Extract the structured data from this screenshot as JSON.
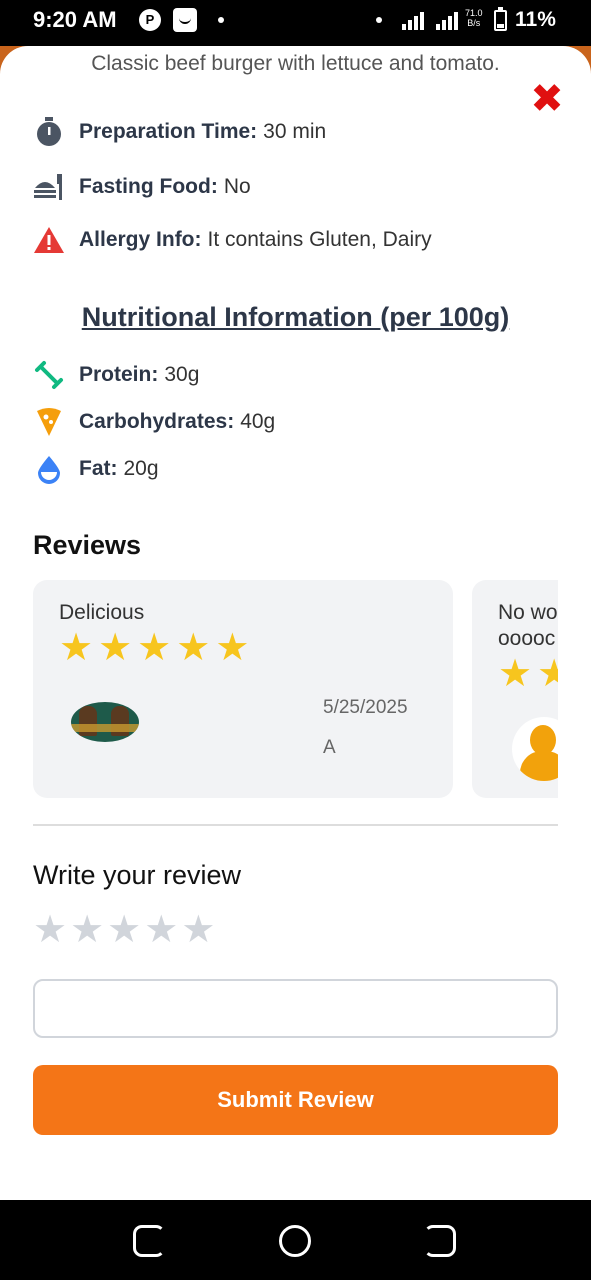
{
  "status_bar": {
    "time": "9:20 AM",
    "app_icon_letter": "P",
    "net_speed_value": "71.0",
    "net_speed_unit": "B/s",
    "battery_percent": "11%"
  },
  "product": {
    "description": "Classic beef burger with lettuce and tomato."
  },
  "details": [
    {
      "icon": "stopwatch-icon",
      "label": "Preparation Time:",
      "value": "30 min",
      "color": "#4b5563"
    },
    {
      "icon": "utensils-icon",
      "label": "Fasting Food:",
      "value": "No",
      "color": "#4b5563"
    },
    {
      "icon": "warning-icon",
      "label": "Allergy Info:",
      "value": "It contains Gluten, Dairy",
      "color": "#e53935"
    }
  ],
  "nutrition": {
    "title": "Nutritional Information (per 100g)",
    "items": [
      {
        "icon": "dumbbell-icon",
        "label": "Protein:",
        "value": "30g",
        "color": "#10b981"
      },
      {
        "icon": "pizza-icon",
        "label": "Carbohydrates:",
        "value": "40g",
        "color": "#f59e0b"
      },
      {
        "icon": "droplet-icon",
        "label": "Fat:",
        "value": "20g",
        "color": "#3b82f6"
      }
    ]
  },
  "reviews": {
    "title": "Reviews",
    "items": [
      {
        "text": "Delicious",
        "rating": 5,
        "date": "5/25/2025",
        "author": "A",
        "avatar": "photo-avatar"
      },
      {
        "text": "No wo",
        "text_line2": "ooooc",
        "rating": 2,
        "avatar": "user-icon"
      }
    ]
  },
  "write_review": {
    "title": "Write your review",
    "rating": 0,
    "input_placeholder": "",
    "submit_label": "Submit Review"
  },
  "colors": {
    "accent": "#f47517",
    "star_filled": "#f7c51e",
    "star_empty": "#d1d5db",
    "close": "#e01010"
  },
  "nav": [
    "recent-apps-icon",
    "home-icon",
    "back-icon"
  ]
}
